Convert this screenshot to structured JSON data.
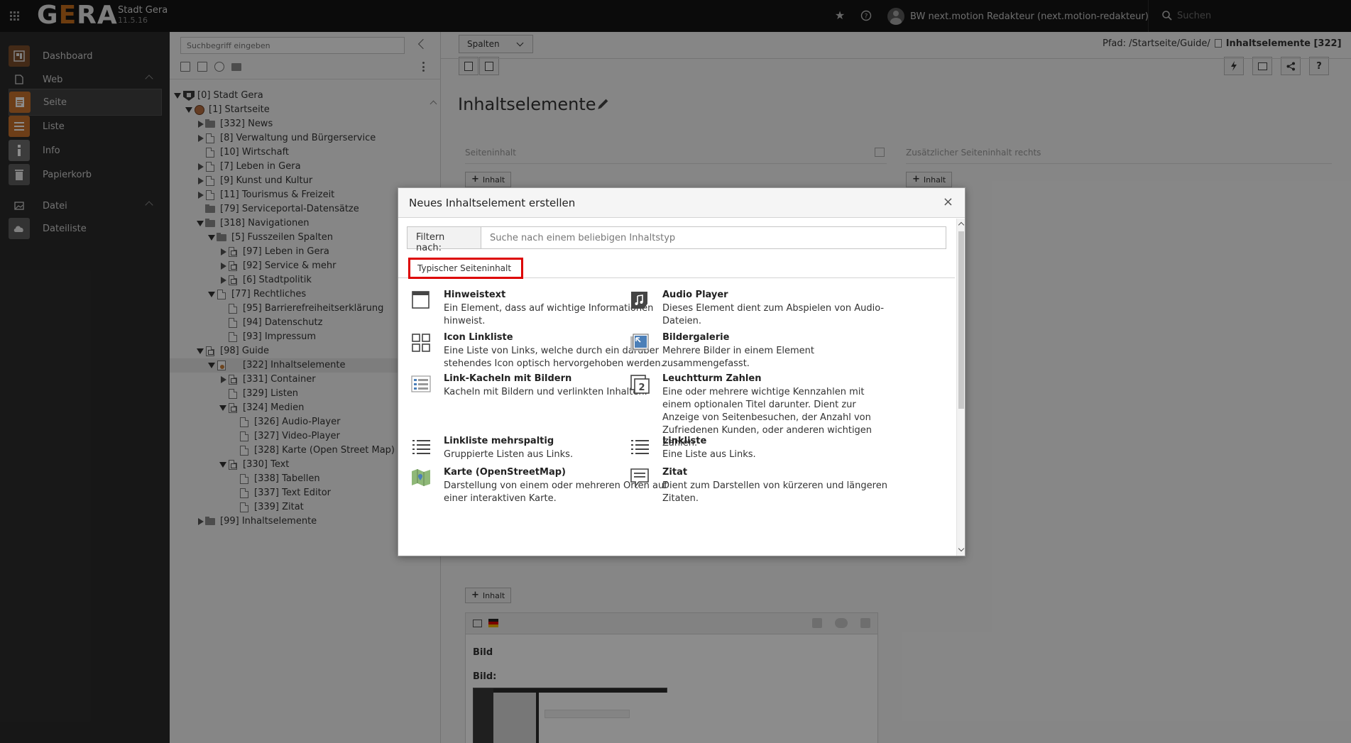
{
  "topbar": {
    "logo_text_1": "G",
    "logo_text_2": "E",
    "logo_text_3": "RA",
    "site_name": "Stadt Gera",
    "version": "11.5.16",
    "user_name": "BW next.motion Redakteur (next.motion-redakteur)",
    "search_placeholder": "Suchen"
  },
  "sidebar": {
    "dashboard": "Dashboard",
    "groups": {
      "web": "Web",
      "datei": "Datei"
    },
    "web_items": [
      "Seite",
      "Liste",
      "Info",
      "Papierkorb"
    ],
    "datei_items": [
      "Dateiliste"
    ]
  },
  "tree": {
    "search_placeholder": "Suchbegriff eingeben",
    "nodes": [
      "[0] Stadt Gera",
      "[1] Startseite",
      "[332] News",
      "[8] Verwaltung und Bürgerservice",
      "[10] Wirtschaft",
      "[7] Leben in Gera",
      "[9] Kunst und Kultur",
      "[11] Tourismus & Freizeit",
      "[79] Serviceportal-Datensätze",
      "[318] Navigationen",
      "[5] Fusszeilen Spalten",
      "[97] Leben in Gera",
      "[92] Service & mehr",
      "[6] Stadtpolitik",
      "[77] Rechtliches",
      "[95] Barrierefreiheitserklärung",
      "[94] Datenschutz",
      "[93] Impressum",
      "[98] Guide",
      "[322] Inhaltselemente",
      "[331] Container",
      "[329] Listen",
      "[324] Medien",
      "[326] Audio-Player",
      "[327] Video-Player",
      "[328] Karte (Open Street Map)",
      "[330] Text",
      "[338] Tabellen",
      "[337] Text Editor",
      "[339] Zitat",
      "[99] Inhaltselemente"
    ]
  },
  "main": {
    "view_select": "Spalten",
    "path_label": "Pfad: /Startseite/Guide/",
    "path_current": "Inhaltselemente [322]",
    "page_title": "Inhaltselemente",
    "col_left": "Seiteninhalt",
    "col_right": "Zusätzlicher Seiteninhalt rechts",
    "add_content": "Inhalt",
    "help_label": "?",
    "ce_title": "Bild",
    "ce_label": "Bild:"
  },
  "modal": {
    "title": "Neues Inhaltselement erstellen",
    "close": "×",
    "filter_label": "Filtern nach:",
    "filter_placeholder": "Suche nach einem beliebigen Inhaltstyp",
    "tab": "Typischer Seiteninhalt",
    "items": [
      {
        "icon": "hint-box-icon",
        "title": "Hinweistext",
        "desc": "Ein Element, dass auf wichtige Informationen hinweist."
      },
      {
        "icon": "music-note-icon",
        "title": "Audio Player",
        "desc": "Dieses Element dient zum Abspielen von Audio-Dateien."
      },
      {
        "icon": "icon-grid-icon",
        "title": "Icon Linkliste",
        "desc": "Eine Liste von Links, welche durch ein darüber stehendes Icon optisch hervorgehoben werden."
      },
      {
        "icon": "gallery-icon",
        "title": "Bildergalerie",
        "desc": "Mehrere Bilder in einem Element zusammengefasst."
      },
      {
        "icon": "tiles-list-icon",
        "title": "Link-Kacheln mit Bildern",
        "desc": "Kacheln mit Bildern und verlinkten Inhalten."
      },
      {
        "icon": "numbers-icon",
        "title": "Leuchtturm Zahlen",
        "desc": "Eine oder mehrere wichtige Kennzahlen mit einem optionalen Titel darunter. Dient zur Anzeige von Seitenbesuchen, der Anzahl von Zufriedenen Kunden, oder anderen wichtigen Zahlen."
      },
      {
        "icon": "list-icon",
        "title": "Linkliste mehrspaltig",
        "desc": "Gruppierte Listen aus Links."
      },
      {
        "icon": "list-icon",
        "title": "Linkliste",
        "desc": "Eine Liste aus Links."
      },
      {
        "icon": "map-icon",
        "title": "Karte (OpenStreetMap)",
        "desc": "Darstellung von einem oder mehreren Orten auf einer interaktiven Karte."
      },
      {
        "icon": "quote-icon",
        "title": "Zitat",
        "desc": "Dient zum Darstellen von kürzeren und längeren Zitaten."
      }
    ]
  }
}
